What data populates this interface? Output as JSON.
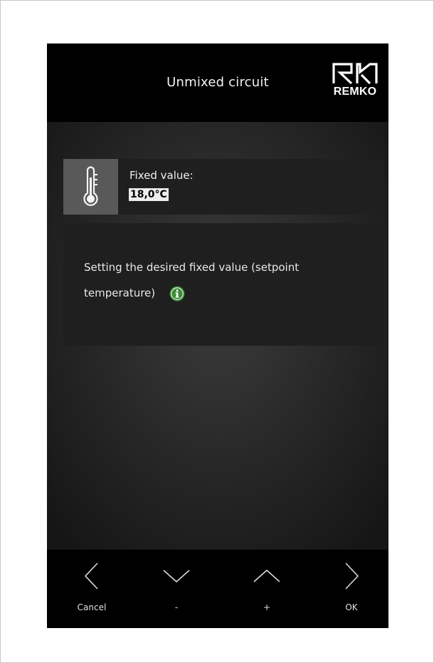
{
  "header": {
    "title": "Unmixed circuit",
    "logo_text": "REMKO"
  },
  "setting": {
    "icon": "thermometer-icon",
    "label": "Fixed value:",
    "value": "18,0°C"
  },
  "description": {
    "text": "Setting the desired fixed value (setpoint temperature)",
    "info_icon": "info-icon",
    "info_color": "#3d8b37"
  },
  "footer": {
    "buttons": [
      {
        "icon": "chevron-left-icon",
        "label": "Cancel"
      },
      {
        "icon": "chevron-down-icon",
        "label": "-"
      },
      {
        "icon": "chevron-up-icon",
        "label": "+"
      },
      {
        "icon": "chevron-right-icon",
        "label": "OK"
      }
    ]
  },
  "colors": {
    "header_bg": "#000000",
    "panel_bg": "#1f1f1f",
    "icon_box_bg": "#595959",
    "value_highlight": "#ececec"
  }
}
